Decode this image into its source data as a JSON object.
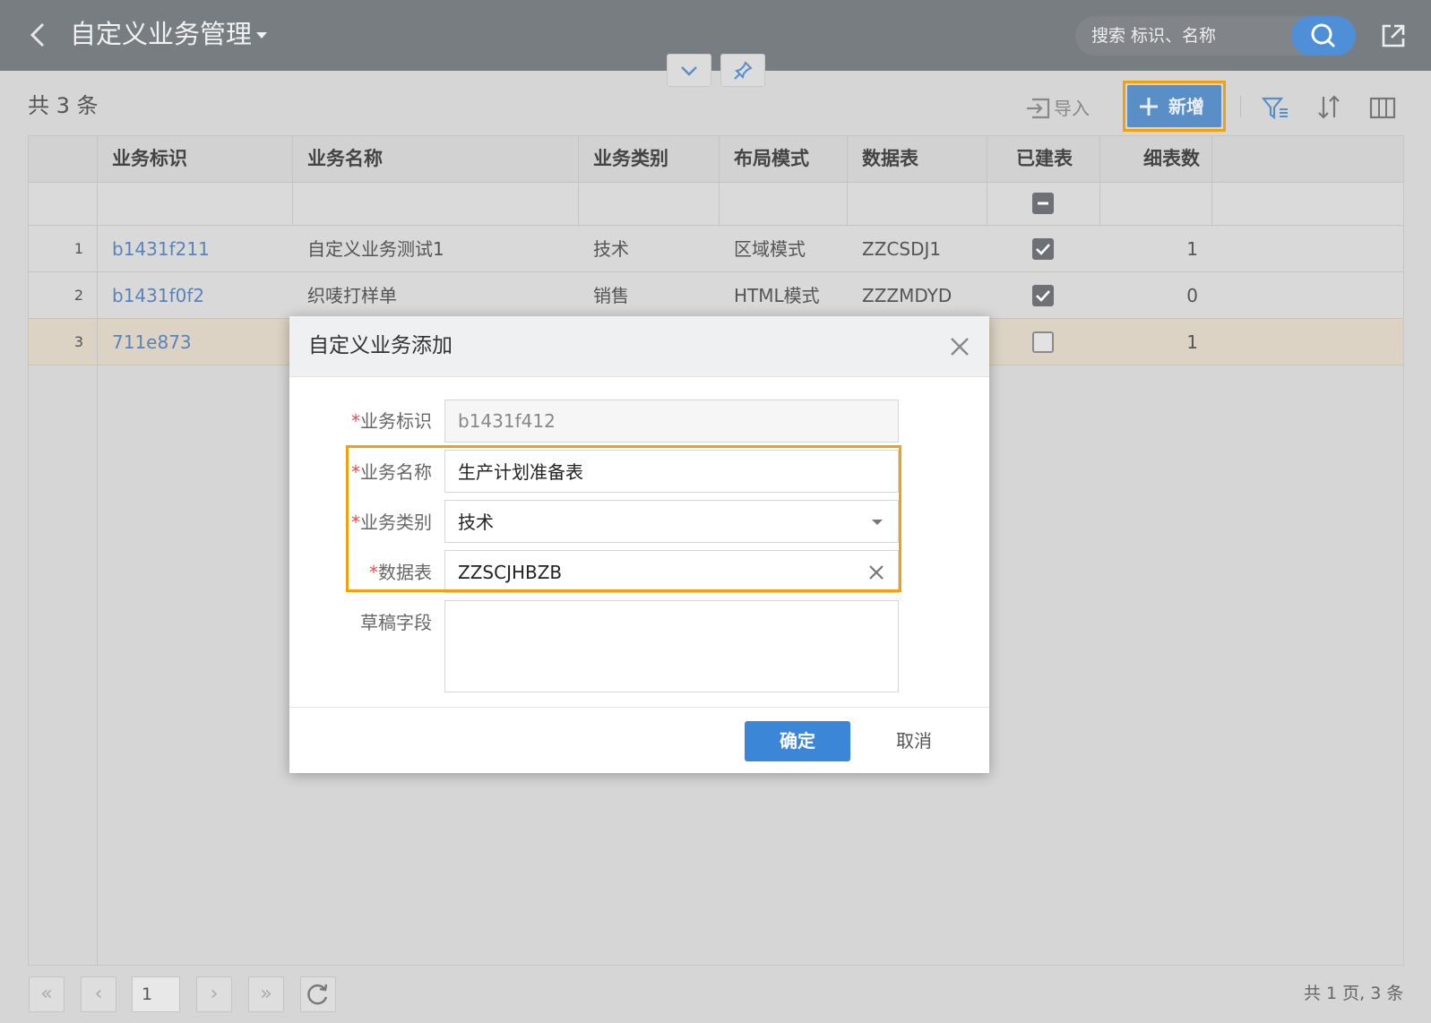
{
  "header": {
    "title": "自定义业务管理",
    "search_placeholder": "搜索 标识、名称"
  },
  "toolbar": {
    "record_count": "共 3 条",
    "import_label": "导入",
    "add_label": "新增"
  },
  "grid": {
    "columns": [
      "业务标识",
      "业务名称",
      "业务类别",
      "布局模式",
      "数据表",
      "已建表",
      "细表数"
    ],
    "rows": [
      {
        "num": "1",
        "id": "b1431f211",
        "name": "自定义业务测试1",
        "category": "技术",
        "layout": "区域模式",
        "table": "ZZCSDJ1",
        "built": true,
        "detail_count": "1"
      },
      {
        "num": "2",
        "id": "b1431f0f2",
        "name": "织唛打样单",
        "category": "销售",
        "layout": "HTML模式",
        "table": "ZZZMDYD",
        "built": true,
        "detail_count": "0"
      },
      {
        "num": "3",
        "id": "711e873",
        "name": "",
        "category": "",
        "layout": "",
        "table": "",
        "built": false,
        "detail_count": "1"
      }
    ]
  },
  "pagination": {
    "current_page": "1",
    "summary": "共 1 页, 3 条"
  },
  "dialog": {
    "title": "自定义业务添加",
    "required_mark": "*",
    "fields": {
      "biz_id": {
        "label": "业务标识",
        "value": "b1431f412"
      },
      "biz_name": {
        "label": "业务名称",
        "value": "生产计划准备表"
      },
      "biz_category": {
        "label": "业务类别",
        "value": "技术"
      },
      "data_table": {
        "label": "数据表",
        "value": "ZZSCJHBZB"
      },
      "draft_field": {
        "label": "草稿字段",
        "value": ""
      }
    },
    "confirm_label": "确定",
    "cancel_label": "取消"
  },
  "colors": {
    "header_bg": "#787d82",
    "accent_blue": "#3c86d8",
    "highlight_orange": "#f0a10e",
    "link_blue": "#5a83b8",
    "selected_row": "#dcd3c4"
  }
}
